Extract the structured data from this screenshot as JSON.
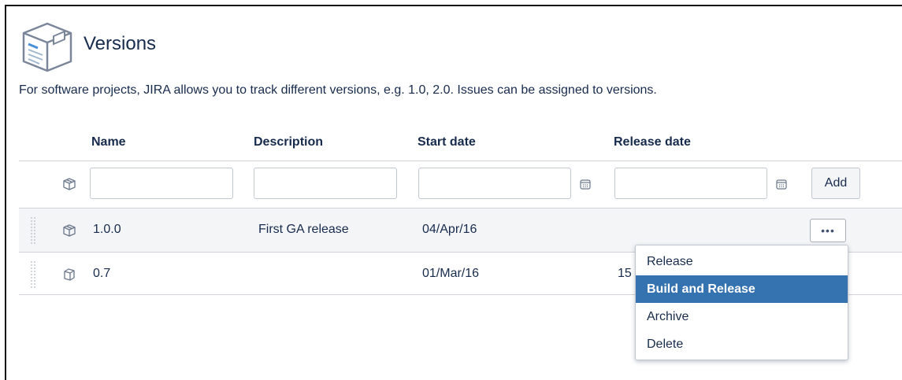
{
  "page": {
    "title": "Versions",
    "intro": "For software projects, JIRA allows you to track different versions, e.g. 1.0, 2.0. Issues can be assigned to versions."
  },
  "table": {
    "columns": [
      "Name",
      "Description",
      "Start date",
      "Release date"
    ],
    "form": {
      "name_value": "",
      "description_value": "",
      "start_date_value": "",
      "release_date_value": "",
      "add_label": "Add"
    },
    "rows": [
      {
        "name": "1.0.0",
        "description": "First GA release",
        "start_date": "04/Apr/16",
        "release_date": "",
        "icon": "package-icon"
      },
      {
        "name": "0.7",
        "description": "",
        "start_date": "01/Mar/16",
        "release_date": "15",
        "icon": "package-outline-icon"
      }
    ],
    "more_label": "•••"
  },
  "dropdown": {
    "items": [
      "Release",
      "Build and Release",
      "Archive",
      "Delete"
    ],
    "highlighted": "Build and Release",
    "highlight_color": "#3572b0"
  }
}
